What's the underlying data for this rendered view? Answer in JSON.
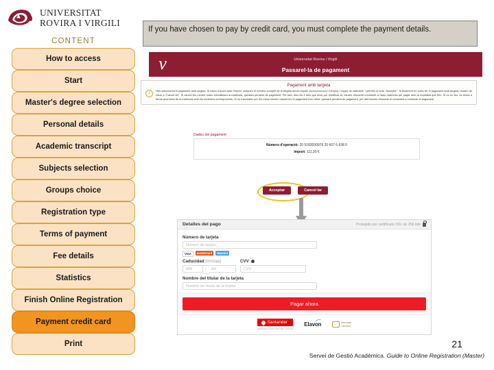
{
  "brand": {
    "line1": "UNIVERSITAT",
    "line2": "ROVIRA I VIRGILI",
    "logo_icon": "urv-logo-icon",
    "logo_color": "#8c1d33"
  },
  "sidebar": {
    "heading": "CONTENT",
    "active_color": "#f2941f",
    "item_color": "#fbe2c4",
    "border_color": "#d8a33a",
    "items": [
      {
        "label": "How to access",
        "active": false
      },
      {
        "label": "Start",
        "active": false
      },
      {
        "label": "Master's degree selection",
        "active": false
      },
      {
        "label": "Personal details",
        "active": false
      },
      {
        "label": "Academic transcript",
        "active": false
      },
      {
        "label": "Subjects selection",
        "active": false
      },
      {
        "label": "Groups choice",
        "active": false
      },
      {
        "label": "Registration type",
        "active": false
      },
      {
        "label": "Terms of payment",
        "active": false
      },
      {
        "label": "Fee details",
        "active": false
      },
      {
        "label": "Statistics",
        "active": false
      },
      {
        "label": "Finish Online Registration",
        "active": false
      },
      {
        "label": "Payment credit card",
        "active": true
      },
      {
        "label": "Print",
        "active": false
      }
    ]
  },
  "note": {
    "text": "If you have chosen to pay by credit card, you must complete the payment details."
  },
  "screenshot": {
    "header": {
      "university": "Universitat Rovira i Virgili",
      "title": "Passarel·la de pagament",
      "bg_color": "#8c1d33"
    },
    "alert": {
      "title": "Pagament amb targeta",
      "icon": "info-icon",
      "text": "Heu seleccionat el pagament amb targeta. Si esteu d'acord amb l'import, indiqueu el número complet de la targeta sense espais (xxxxxxxxxxxx) i mes(os) i any(s) de caducitat, i premeu el botó \"Acceptar\". Si finalment no voleu fer el pagament amb targeta, haureu de clicar a \"Cancel·lar\". Si cancel·leu mentre esteu formalitzant la matrícula, quedarà pendent de pagament. Per tant, dins els 5 dies que teniu per modificar-la, haureu d'accedir novament a l'auto-matrícula per pagar amb la modalitat que triïn. Si no ho feu, es tenirà a terme anul·lació de la matrícula amb els recàrrecs corresponents. Si no s'accedeix per Els meus rebuts i cancel·leu el pagament d'un rebut, quedarà pendent de pagament, per tant haureu d'accedir-hi novament a continuar el pagament"
    },
    "payment_data": {
      "label": "Dades del pagament",
      "rows": [
        {
          "key": "Número d'operació:",
          "value": "20 5182030979 20 607 6 638 0"
        },
        {
          "key": "Import:",
          "value": "111,30 €"
        }
      ]
    },
    "buttons": {
      "accept": "Acceptar",
      "cancel": "Cancel·lar",
      "highlight_color": "#e8c20b",
      "arrow_icon": "down-arrow-icon"
    },
    "pay_form": {
      "header_title": "Detalles del pago",
      "header_secure": "Protegido por certificado SSL de 256 bits",
      "lock_icon": "lock-icon",
      "card_number_label": "Número de tarjeta",
      "card_number_placeholder": "Número de tarjeta",
      "card_logos": [
        "VISA",
        "mastercard",
        "Maestro"
      ],
      "expiry_label": "Caducidad",
      "expiry_hint": "(mm/aa)",
      "expiry_mm_placeholder": "MM",
      "expiry_sep": "/",
      "expiry_yy_placeholder": "AA",
      "cvv_label": "CVV",
      "cvv_icon": "help-icon",
      "cvv_placeholder": "CVV",
      "holder_label": "Nombre del titular de la tarjeta",
      "holder_placeholder": "Nombre del titular de la tarjeta",
      "pay_button": "Pagar ahora",
      "pay_button_color": "#ee1c25",
      "footer_logos": {
        "santander": "Santander",
        "elavon": "Elavon",
        "third_line1": "Merchant",
        "third_line2": "Services"
      },
      "santander_note": "Santander Elavon Merchant Services"
    }
  },
  "footer": {
    "page_number": "21",
    "text_plain": "Servei de Gestió Acadèmica. ",
    "text_italic": "Guide to Online Registration (Master)"
  }
}
